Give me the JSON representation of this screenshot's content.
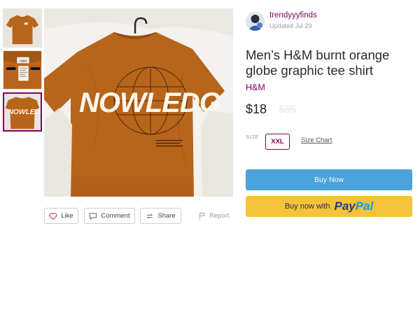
{
  "seller": {
    "username": "trendyyyfinds",
    "updated": "Updated Jul 29"
  },
  "listing": {
    "title": "Men’s H&M burnt orange globe graphic tee shirt",
    "brand": "H&M",
    "price": "$18",
    "original_price": "$35",
    "size_label": "SIZE",
    "size": "XXL",
    "size_chart": "Size Chart"
  },
  "image": {
    "shirt_print_text": "NOWLEDG",
    "tag_brand": "H&M",
    "selected_thumbnail": 3
  },
  "actions": {
    "like": "Like",
    "comment": "Comment",
    "share": "Share",
    "report": "Report"
  },
  "buttons": {
    "buy_now": "Buy Now",
    "paypal_prefix": "Buy now with",
    "paypal_pay": "Pay",
    "paypal_pal": "Pal"
  },
  "colors": {
    "brand_accent": "#7f0353",
    "buy_now_bg": "#4aa3dc",
    "paypal_bg": "#f5c33b",
    "shirt_orange": "#b8651c"
  }
}
